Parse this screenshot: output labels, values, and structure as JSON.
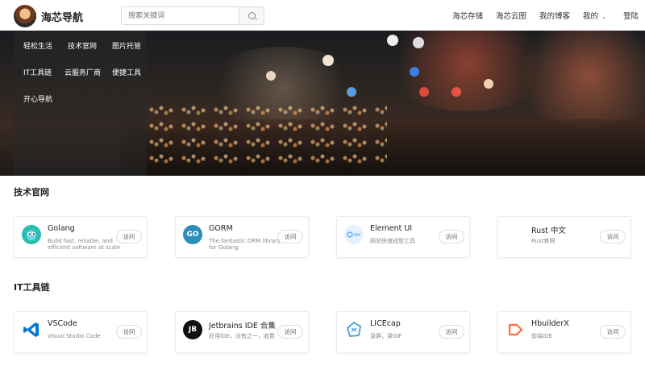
{
  "header": {
    "brand": "海芯导航",
    "search_placeholder": "搜索关键词",
    "nav": [
      "海芯存储",
      "海芯云图",
      "我的博客",
      "我的",
      "登陆"
    ]
  },
  "categories": [
    "轻松生活",
    "技术官网",
    "图片托管",
    "IT工具链",
    "云服务厂商",
    "便捷工具",
    "开心导航"
  ],
  "sections": [
    {
      "title": "技术官网",
      "cards": [
        {
          "name": "Golang",
          "desc": "Build fast, reliable, and efficient software at scale",
          "visit": "访问",
          "icon": "gopher-icon",
          "icon_color": "#29beb0"
        },
        {
          "name": "GORM",
          "desc": "The fantastic ORM library for Golang",
          "visit": "访问",
          "icon": "gorm-icon",
          "icon_color": "#2c8ebb"
        },
        {
          "name": "Element UI",
          "desc": "网站快速成型工具",
          "visit": "访问",
          "icon": "element-icon",
          "icon_color": "#d9ecff"
        },
        {
          "name": "Rust 中文",
          "desc": "Rust官网",
          "visit": "访问",
          "icon": "rust-icon",
          "icon_color": "#ffffff"
        }
      ]
    },
    {
      "title": "IT工具链",
      "cards": [
        {
          "name": "VSCode",
          "desc": "Visual Studio Code",
          "visit": "访问",
          "icon": "vscode-icon",
          "icon_color": "#0065a9"
        },
        {
          "name": "Jetbrains IDE 合集",
          "desc": "好用IDE，没有之一，收费",
          "visit": "访问",
          "icon": "jetbrains-icon",
          "icon_color": "#111111"
        },
        {
          "name": "LICEcap",
          "desc": "录屏，录GIF",
          "visit": "访问",
          "icon": "licecap-icon",
          "icon_color": "#5aa6d6"
        },
        {
          "name": "HbuilderX",
          "desc": "前端IDE",
          "visit": "访问",
          "icon": "hbuilderx-icon",
          "icon_color": "#ff6b3d"
        }
      ]
    }
  ]
}
